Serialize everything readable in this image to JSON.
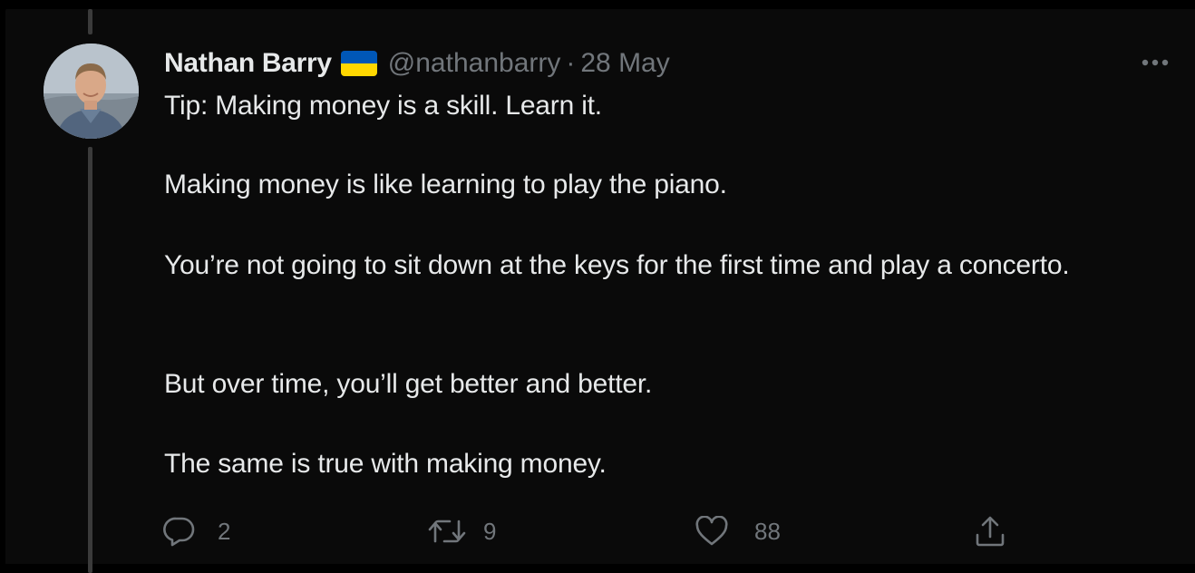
{
  "tweet": {
    "author": {
      "display_name": "Nathan Barry",
      "handle": "@nathanbarry",
      "flag_emoji": "ukraine-flag-icon",
      "flag_colors": [
        "#0057b7",
        "#ffd700"
      ]
    },
    "separator": "·",
    "date": "28 May",
    "paragraphs": [
      "Tip: Making money is a skill. Learn it.",
      "Making money is like learning to play the piano.",
      "You’re not going to sit down at the keys for the first time and play a concerto.",
      "But over time, you’ll get better and better.",
      "The same is true with making money."
    ],
    "actions": {
      "reply": {
        "icon": "reply-icon",
        "count": "2"
      },
      "retweet": {
        "icon": "retweet-icon",
        "count": "9"
      },
      "like": {
        "icon": "heart-icon",
        "count": "88"
      },
      "share": {
        "icon": "share-icon"
      }
    },
    "more_icon": "more-options-icon"
  },
  "colors": {
    "background": "#000000",
    "card": "#0a0a0a",
    "text_primary": "#e7e9ea",
    "text_secondary": "#71767b",
    "thread_line": "#3b3b3b"
  }
}
